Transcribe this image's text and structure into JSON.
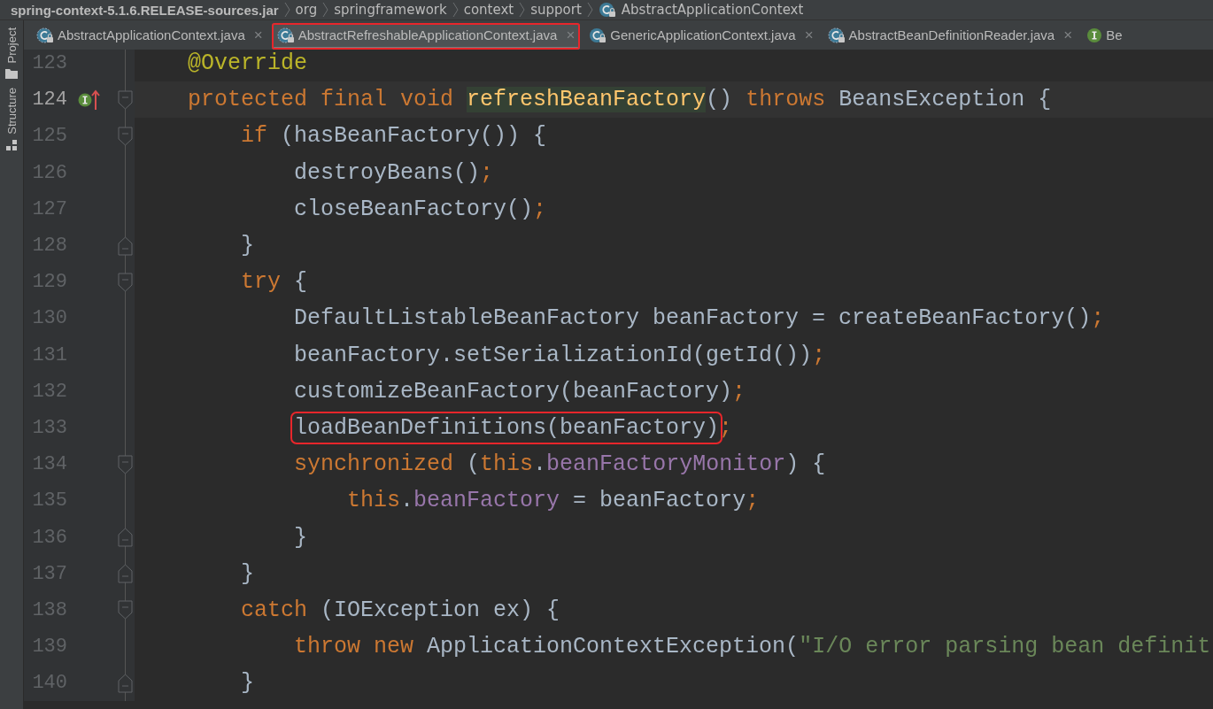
{
  "breadcrumb": [
    {
      "label": "spring-context-5.1.6.RELEASE-sources.jar",
      "kind": "archive"
    },
    {
      "label": "org",
      "kind": "package"
    },
    {
      "label": "springframework",
      "kind": "package"
    },
    {
      "label": "context",
      "kind": "package"
    },
    {
      "label": "support",
      "kind": "package"
    },
    {
      "label": "AbstractApplicationContext",
      "kind": "class"
    }
  ],
  "tool_strip": [
    {
      "label": "Project",
      "kind": "project"
    },
    {
      "label": "Structure",
      "kind": "structure"
    }
  ],
  "tabs": [
    {
      "label": "AbstractApplicationContext.java",
      "kind": "abstract-class",
      "selected": false,
      "annotated": false,
      "closable": true
    },
    {
      "label": "AbstractRefreshableApplicationContext.java",
      "kind": "abstract-class",
      "selected": true,
      "annotated": true,
      "closable": true
    },
    {
      "label": "GenericApplicationContext.java",
      "kind": "class",
      "selected": false,
      "annotated": false,
      "closable": true
    },
    {
      "label": "AbstractBeanDefinitionReader.java",
      "kind": "abstract-class",
      "selected": false,
      "annotated": false,
      "closable": true
    },
    {
      "label": "Be",
      "kind": "interface",
      "selected": false,
      "annotated": false,
      "closable": false
    }
  ],
  "close_glyph": "×",
  "lines": [
    {
      "number": "123",
      "kind": "plain",
      "current": false,
      "implements": false,
      "tokens": [
        {
          "text": "@Override",
          "kind": "annotation"
        }
      ]
    },
    {
      "number": "124",
      "kind": "fold-open",
      "current": true,
      "implements": true,
      "tokens": [
        {
          "text": "protected final void ",
          "kind": "keyword"
        },
        {
          "text": "refreshBeanFactory",
          "kind": "method",
          "highlighted": true
        },
        {
          "text": "() ",
          "kind": "plain"
        },
        {
          "text": "throws ",
          "kind": "keyword"
        },
        {
          "text": "BeansException {",
          "kind": "plain"
        }
      ]
    },
    {
      "number": "125",
      "kind": "fold-open",
      "current": false,
      "implements": false,
      "tokens": [
        {
          "text": "if ",
          "kind": "keyword"
        },
        {
          "text": "(hasBeanFactory()) {",
          "kind": "plain"
        }
      ]
    },
    {
      "number": "126",
      "kind": "plain",
      "current": false,
      "implements": false,
      "tokens": [
        {
          "text": "destroyBeans()",
          "kind": "plain"
        },
        {
          "text": ";",
          "kind": "keyword"
        }
      ]
    },
    {
      "number": "127",
      "kind": "plain",
      "current": false,
      "implements": false,
      "tokens": [
        {
          "text": "closeBeanFactory()",
          "kind": "plain"
        },
        {
          "text": ";",
          "kind": "keyword"
        }
      ]
    },
    {
      "number": "128",
      "kind": "fold-close",
      "current": false,
      "implements": false,
      "tokens": [
        {
          "text": "}",
          "kind": "plain"
        }
      ]
    },
    {
      "number": "129",
      "kind": "fold-open",
      "current": false,
      "implements": false,
      "tokens": [
        {
          "text": "try ",
          "kind": "keyword"
        },
        {
          "text": "{",
          "kind": "plain"
        }
      ]
    },
    {
      "number": "130",
      "kind": "plain",
      "current": false,
      "implements": false,
      "tokens": [
        {
          "text": "DefaultListableBeanFactory beanFactory = createBeanFactory()",
          "kind": "plain"
        },
        {
          "text": ";",
          "kind": "keyword"
        }
      ]
    },
    {
      "number": "131",
      "kind": "plain",
      "current": false,
      "implements": false,
      "tokens": [
        {
          "text": "beanFactory.setSerializationId(getId())",
          "kind": "plain"
        },
        {
          "text": ";",
          "kind": "keyword"
        }
      ]
    },
    {
      "number": "132",
      "kind": "plain",
      "current": false,
      "implements": false,
      "tokens": [
        {
          "text": "customizeBeanFactory(beanFactory)",
          "kind": "plain"
        },
        {
          "text": ";",
          "kind": "keyword"
        }
      ]
    },
    {
      "number": "133",
      "kind": "plain",
      "current": false,
      "implements": false,
      "tokens": [
        {
          "text": "loadBeanDefinitions(beanFactory)",
          "kind": "plain",
          "boxed": true
        },
        {
          "text": ";",
          "kind": "keyword"
        }
      ]
    },
    {
      "number": "134",
      "kind": "fold-open",
      "current": false,
      "implements": false,
      "tokens": [
        {
          "text": "synchronized ",
          "kind": "keyword"
        },
        {
          "text": "(",
          "kind": "plain"
        },
        {
          "text": "this",
          "kind": "keyword"
        },
        {
          "text": ".",
          "kind": "plain"
        },
        {
          "text": "beanFactoryMonitor",
          "kind": "field"
        },
        {
          "text": ") {",
          "kind": "plain"
        }
      ]
    },
    {
      "number": "135",
      "kind": "plain",
      "current": false,
      "implements": false,
      "tokens": [
        {
          "text": "this",
          "kind": "keyword"
        },
        {
          "text": ".",
          "kind": "plain"
        },
        {
          "text": "beanFactory",
          "kind": "field"
        },
        {
          "text": " = beanFactory",
          "kind": "plain"
        },
        {
          "text": ";",
          "kind": "keyword"
        }
      ]
    },
    {
      "number": "136",
      "kind": "fold-close",
      "current": false,
      "implements": false,
      "tokens": [
        {
          "text": "}",
          "kind": "plain"
        }
      ]
    },
    {
      "number": "137",
      "kind": "fold-close",
      "current": false,
      "implements": false,
      "tokens": [
        {
          "text": "}",
          "kind": "plain"
        }
      ]
    },
    {
      "number": "138",
      "kind": "fold-open",
      "current": false,
      "implements": false,
      "tokens": [
        {
          "text": "catch ",
          "kind": "keyword"
        },
        {
          "text": "(IOException ex) {",
          "kind": "plain"
        }
      ]
    },
    {
      "number": "139",
      "kind": "plain",
      "current": false,
      "implements": false,
      "tokens": [
        {
          "text": "throw new ",
          "kind": "keyword"
        },
        {
          "text": "ApplicationContextException(",
          "kind": "plain"
        },
        {
          "text": "\"I/O error parsing bean definit",
          "kind": "string"
        }
      ]
    },
    {
      "number": "140",
      "kind": "fold-close",
      "current": false,
      "implements": false,
      "tokens": [
        {
          "text": "}",
          "kind": "plain"
        }
      ]
    }
  ]
}
